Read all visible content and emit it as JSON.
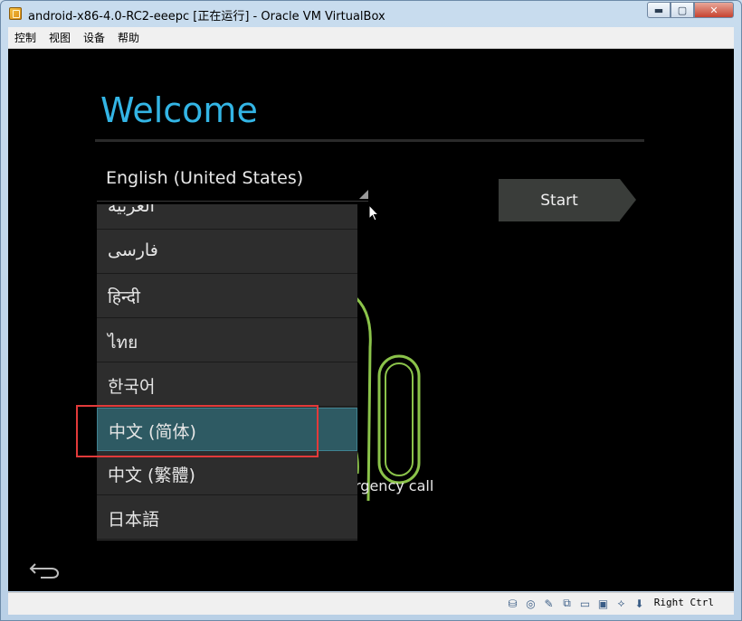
{
  "window": {
    "title": "android-x86-4.0-RC2-eeepc [正在运行] - Oracle VM VirtualBox",
    "controls": {
      "minimize": "▬",
      "maximize": "▢",
      "close": "✕"
    }
  },
  "menu": {
    "items": [
      "控制",
      "视图",
      "设备",
      "帮助"
    ]
  },
  "android": {
    "welcome_title": "Welcome",
    "language_selected": "English (United States)",
    "start_label": "Start",
    "emergency_text": "rgency call",
    "language_options": [
      "العربية",
      "فارسی",
      "हिन्दी",
      "ไทย",
      "한국어",
      "中文 (简体)",
      "中文 (繁體)",
      "日本語"
    ],
    "selected_option_index": 5,
    "accent_color": "#33b5e5",
    "android_green": "#8bc34a"
  },
  "statusbar": {
    "host_key": "Right Ctrl",
    "icons": [
      "hard-disk-icon",
      "optical-drive-icon",
      "usb-icon",
      "network-icon",
      "shared-folder-icon",
      "display-icon",
      "capture-icon",
      "mouse-integration-icon"
    ]
  }
}
